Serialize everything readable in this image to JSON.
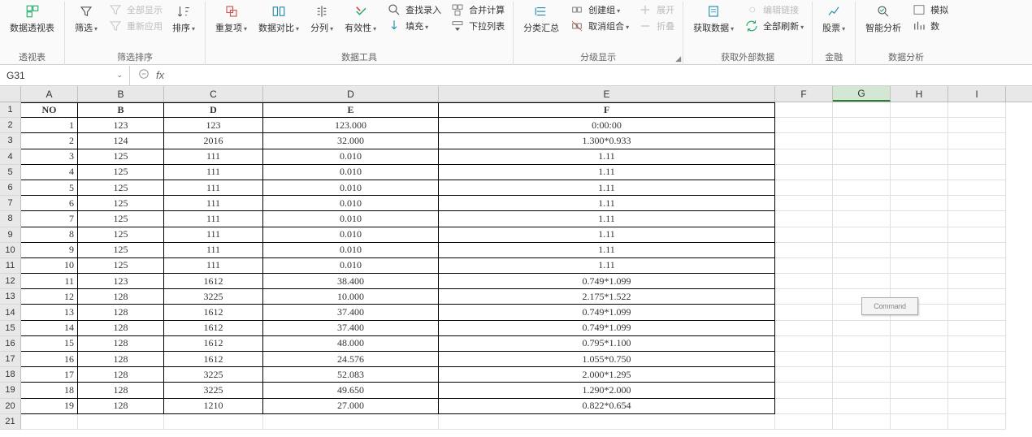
{
  "ribbon": {
    "groups": [
      {
        "label": "透视表",
        "items": [
          {
            "name": "pivot",
            "label": "数据透视表",
            "icon": "pivot"
          }
        ]
      },
      {
        "label": "筛选排序",
        "items_big": [
          {
            "name": "filter",
            "label": "筛选",
            "icon": "filter",
            "arrow": true
          }
        ],
        "items_small": [
          {
            "name": "show-all",
            "label": "全部显示",
            "disabled": true,
            "icon": "show-all"
          },
          {
            "name": "reapply",
            "label": "重新应用",
            "disabled": true,
            "icon": "reapply"
          }
        ],
        "items_big2": [
          {
            "name": "sort",
            "label": "排序",
            "icon": "sort",
            "arrow": true
          }
        ]
      },
      {
        "label": "数据工具",
        "items": [
          {
            "name": "duplicates",
            "label": "重复项",
            "icon": "dup",
            "arrow": true
          },
          {
            "name": "data-compare",
            "label": "数据对比",
            "icon": "compare",
            "arrow": true
          },
          {
            "name": "split-col",
            "label": "分列",
            "icon": "split",
            "arrow": true
          },
          {
            "name": "validation",
            "label": "有效性",
            "icon": "valid",
            "arrow": true
          }
        ],
        "items_small": [
          {
            "name": "find-entry",
            "label": "查找录入",
            "icon": "find"
          },
          {
            "name": "fill",
            "label": "填充",
            "icon": "fill",
            "arrow": true
          }
        ],
        "items_small2": [
          {
            "name": "consolidate",
            "label": "合并计算",
            "icon": "consol"
          },
          {
            "name": "dropdown-list",
            "label": "下拉列表",
            "icon": "dropdown"
          }
        ]
      },
      {
        "label": "分级显示",
        "corner": true,
        "items": [
          {
            "name": "subtotal",
            "label": "分类汇总",
            "icon": "subtotal"
          }
        ],
        "items_small": [
          {
            "name": "group",
            "label": "创建组",
            "icon": "group",
            "arrow": true
          },
          {
            "name": "ungroup",
            "label": "取消组合",
            "icon": "ungroup",
            "arrow": true
          }
        ],
        "items_small2": [
          {
            "name": "expand",
            "label": "展开",
            "icon": "expand",
            "disabled": true
          },
          {
            "name": "collapse",
            "label": "折叠",
            "icon": "collapse",
            "disabled": true
          }
        ]
      },
      {
        "label": "获取外部数据",
        "items": [
          {
            "name": "get-data",
            "label": "获取数据",
            "icon": "getdata",
            "arrow": true
          }
        ],
        "items_small": [
          {
            "name": "edit-link",
            "label": "编辑链接",
            "icon": "editlink",
            "disabled": true
          },
          {
            "name": "refresh-all",
            "label": "全部刷新",
            "icon": "refresh",
            "arrow": true
          }
        ]
      },
      {
        "label": "金融",
        "items": [
          {
            "name": "stock",
            "label": "股票",
            "icon": "stock",
            "arrow": true
          }
        ]
      },
      {
        "label": "数据分析",
        "items": [
          {
            "name": "smart-analysis",
            "label": "智能分析",
            "icon": "smart"
          }
        ],
        "items_small": [
          {
            "name": "simulate",
            "label": "模拟",
            "icon": "sim",
            "cut": true
          },
          {
            "name": "data-tool",
            "label": "数",
            "icon": "dtool",
            "cut": true
          }
        ]
      }
    ]
  },
  "formula_bar": {
    "name_box": "G31",
    "fx": "fx",
    "formula": ""
  },
  "columns": [
    {
      "letter": "A",
      "w": "wA"
    },
    {
      "letter": "B",
      "w": "wB"
    },
    {
      "letter": "C",
      "w": "wC"
    },
    {
      "letter": "D",
      "w": "wD"
    },
    {
      "letter": "E",
      "w": "wE"
    },
    {
      "letter": "F",
      "w": "wF"
    },
    {
      "letter": "G",
      "w": "wG",
      "selected": true
    },
    {
      "letter": "H",
      "w": "wH"
    },
    {
      "letter": "I",
      "w": "wI"
    }
  ],
  "table": {
    "headers": [
      "NO",
      "B",
      "D",
      "E",
      "F"
    ],
    "rows": [
      [
        "1",
        "123",
        "123",
        "123.000",
        "0:00:00"
      ],
      [
        "2",
        "124",
        "2016",
        "32.000",
        "1.300*0.933"
      ],
      [
        "3",
        "125",
        "111",
        "0.010",
        "1.11"
      ],
      [
        "4",
        "125",
        "111",
        "0.010",
        "1.11"
      ],
      [
        "5",
        "125",
        "111",
        "0.010",
        "1.11"
      ],
      [
        "6",
        "125",
        "111",
        "0.010",
        "1.11"
      ],
      [
        "7",
        "125",
        "111",
        "0.010",
        "1.11"
      ],
      [
        "8",
        "125",
        "111",
        "0.010",
        "1.11"
      ],
      [
        "9",
        "125",
        "111",
        "0.010",
        "1.11"
      ],
      [
        "10",
        "125",
        "111",
        "0.010",
        "1.11"
      ],
      [
        "11",
        "123",
        "1612",
        "38.400",
        "0.749*1.099"
      ],
      [
        "12",
        "128",
        "3225",
        "10.000",
        "2.175*1.522"
      ],
      [
        "13",
        "128",
        "1612",
        "37.400",
        "0.749*1.099"
      ],
      [
        "14",
        "128",
        "1612",
        "37.400",
        "0.749*1.099"
      ],
      [
        "15",
        "128",
        "1612",
        "48.000",
        "0.795*1.100"
      ],
      [
        "16",
        "128",
        "1612",
        "24.576",
        "1.055*0.750"
      ],
      [
        "17",
        "128",
        "3225",
        "52.083",
        "2.000*1.295"
      ],
      [
        "18",
        "128",
        "3225",
        "49.650",
        "1.290*2.000"
      ],
      [
        "19",
        "128",
        "1210",
        "27.000",
        "0.822*0.654"
      ]
    ]
  },
  "floating_label": "Command",
  "row_count": 21
}
